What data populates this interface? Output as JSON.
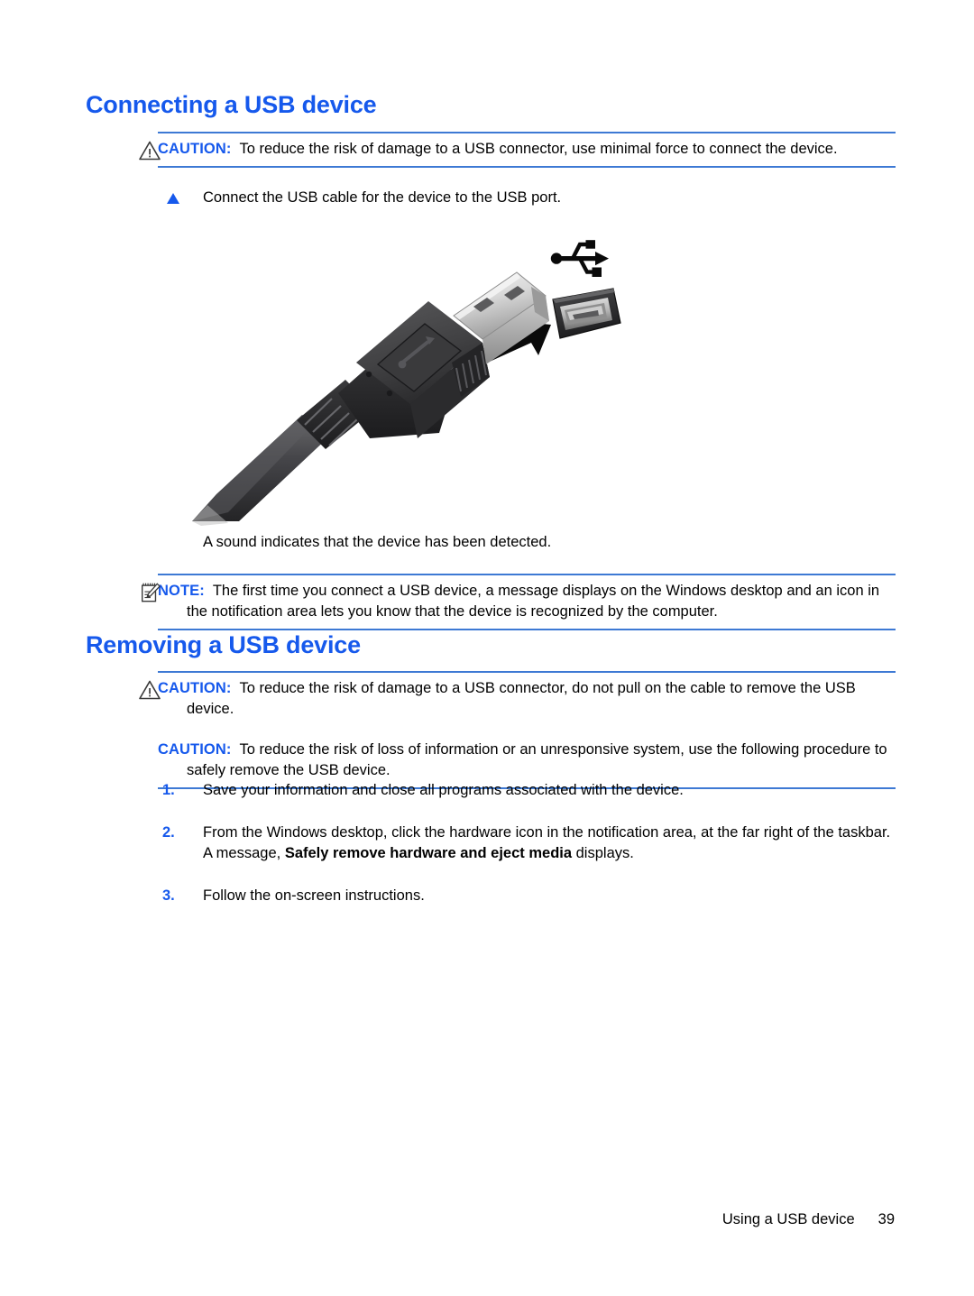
{
  "page": {
    "heading_connecting": "Connecting a USB device",
    "heading_removing": "Removing a USB device"
  },
  "caution_connect": {
    "icon": "caution-triangle-icon",
    "label": "CAUTION:",
    "body": "To reduce the risk of damage to a USB connector, use minimal force to connect the device."
  },
  "step_connect": {
    "bullet": "triangle-bullet-icon",
    "text": "Connect the USB cable for the device to the USB port."
  },
  "figure": {
    "name": "usb-cable-plug-and-port-illustration",
    "usb_symbol": "usb-trident-icon",
    "arrow": "insert-direction-arrow-icon",
    "port": "usb-port-receptacle",
    "plug": "usb-type-a-plug",
    "cable": "usb-cable"
  },
  "sound_detected": {
    "text": "A sound indicates that the device has been detected."
  },
  "note": {
    "icon": "note-pad-pencil-icon",
    "label": "NOTE:",
    "body": "The first time you connect a USB device, a message displays on the Windows desktop and an icon in the notification area lets you know that the device is recognized by the computer."
  },
  "caution_remove_1": {
    "icon": "caution-triangle-icon",
    "label": "CAUTION:",
    "body": "To reduce the risk of damage to a USB connector, do not pull on the cable to remove the USB device."
  },
  "caution_remove_2": {
    "label": "CAUTION:",
    "body": "To reduce the risk of loss of information or an unresponsive system, use the following procedure to safely remove the USB device."
  },
  "steps": [
    {
      "number": "1.",
      "text_before": "Save your information and close all programs associated with the device.",
      "bold": "",
      "text_after": ""
    },
    {
      "number": "2.",
      "text_before": "From the Windows desktop, click the hardware icon in the notification area, at the far right of the taskbar. A message, ",
      "bold": "Safely remove hardware and eject media",
      "text_after": " displays."
    },
    {
      "number": "3.",
      "text_before": "Follow the on-screen instructions.",
      "bold": "",
      "text_after": ""
    }
  ],
  "footer": {
    "section": "Using a USB device",
    "page_number": "39"
  },
  "colors": {
    "heading_blue": "#1659ec",
    "rule_blue": "#3d79d4",
    "body_black": "#000000"
  }
}
